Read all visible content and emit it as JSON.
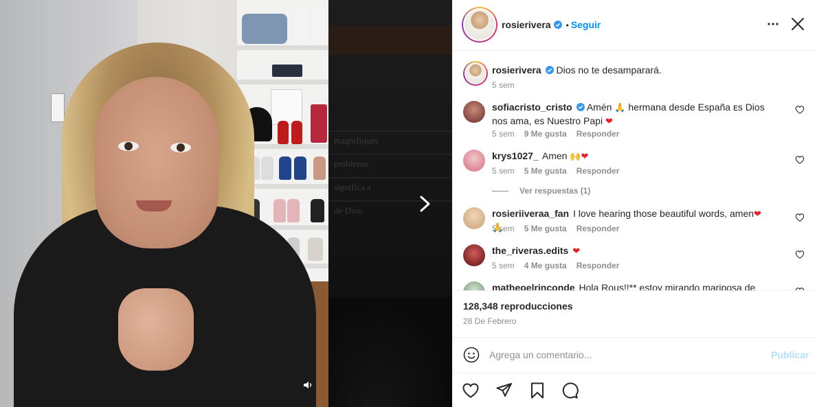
{
  "post": {
    "username": "rosierivera",
    "follow_label": "Seguir",
    "separator": "•"
  },
  "caption": {
    "username": "rosierivera",
    "text": "Dios no te desamparará.",
    "time": "5 sem"
  },
  "comments": [
    {
      "username": "sofiacristo_cristo",
      "text_a": "Amén",
      "emoji_a": "🙏",
      "text_b": "hermana desde España ᴇs Dios nos ama, es Nuestro Papi",
      "emoji_b": "❤",
      "time": "5 sem",
      "likes": "9 Me gusta",
      "reply": "Responder"
    },
    {
      "username": "krys1027_",
      "text_a": "Amen",
      "emoji_a": "🙌",
      "emoji_b": "❤",
      "time": "5 sem",
      "likes": "5 Me gusta",
      "reply": "Responder"
    },
    {
      "username": "rosieriiveraa_fan",
      "text_a": "I love hearing those beautiful words, amen",
      "emoji_a": "❤",
      "emoji_b": "🙏",
      "time": "5 sem",
      "likes": "5 Me gusta",
      "reply": "Responder"
    },
    {
      "username": "the_riveras.edits",
      "emoji_a": "❤",
      "time": "5 sem",
      "likes": "4 Me gusta",
      "reply": "Responder"
    },
    {
      "username": "matheoelrinconde",
      "text_a": "Hola Rous!!** estoy mirando mariposa de"
    }
  ],
  "view_replies": "Ver respuestas (1)",
  "stats": {
    "views": "128,348 reproducciones",
    "date": "28 De Febrero"
  },
  "add_comment": {
    "placeholder": "Agrega un comentario...",
    "publish_label": "Publicar"
  },
  "background_text": [
    "magnifiques",
    "problema.",
    "significa a",
    "de Dios."
  ],
  "colors": {
    "accent": "#0095f6",
    "publish_disabled": "#b2dffc",
    "verified": "#3897f0",
    "heart": "#ed1c24"
  },
  "icons": [
    "more-icon",
    "close-icon",
    "verified-icon",
    "heart-icon",
    "share-icon",
    "bookmark-icon",
    "comment-icon",
    "smile-icon",
    "volume-icon",
    "chevron-right-icon"
  ]
}
